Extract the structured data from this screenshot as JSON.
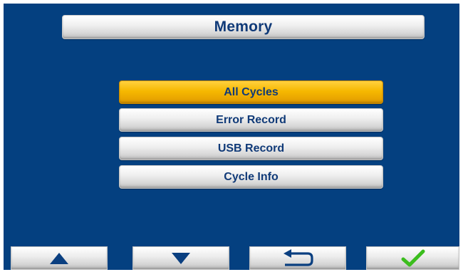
{
  "header": {
    "title": "Memory"
  },
  "menu": {
    "items": [
      {
        "label": "All Cycles",
        "selected": true
      },
      {
        "label": "Error Record",
        "selected": false
      },
      {
        "label": "USB Record",
        "selected": false
      },
      {
        "label": "Cycle Info",
        "selected": false
      }
    ]
  },
  "footer": {
    "buttons": [
      {
        "name": "up",
        "icon": "up-arrow-icon"
      },
      {
        "name": "down",
        "icon": "down-arrow-icon"
      },
      {
        "name": "back",
        "icon": "return-arrow-icon"
      },
      {
        "name": "confirm",
        "icon": "checkmark-icon"
      }
    ]
  },
  "colors": {
    "background": "#044080",
    "text": "#103a78",
    "selected": "#f6b800",
    "icon": "#0a3f80",
    "check": "#3bbd1d"
  }
}
